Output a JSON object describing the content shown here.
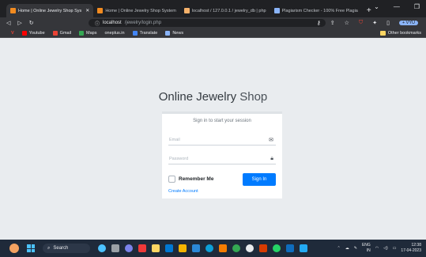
{
  "browser": {
    "tabs": [
      {
        "label": "Home | Online Jewelry Shop Sys",
        "color": "#f28b20",
        "active": true
      },
      {
        "label": "Home | Online Jewelry Shop System",
        "color": "#f28b20",
        "active": false
      },
      {
        "label": "localhost / 127.0.0.1 / jewelry_db | php",
        "color": "#f6b26b",
        "active": false
      },
      {
        "label": "Plagiarism Checker - 100% Free Plagia",
        "color": "#8ab4f8",
        "active": false
      }
    ],
    "new_tab": "+",
    "url_host": "localhost",
    "url_path": "/jewelry/login.php",
    "profile_label": "+ VYU",
    "bookmarks": [
      {
        "label": "Youtube",
        "color": "#ff0000"
      },
      {
        "label": "Gmail",
        "color": "#ea4335"
      },
      {
        "label": "Maps",
        "color": "#34a853"
      },
      {
        "label": "oneplus.in",
        "color": "#9aa0a6"
      },
      {
        "label": "Translate",
        "color": "#4285f4"
      },
      {
        "label": "News",
        "color": "#8ab4f8"
      }
    ],
    "other_bookmarks": "Other bookmarks"
  },
  "login": {
    "logo_bold": "Online Jewelry",
    "logo_light": " Shop",
    "message": "Sign in to start your session",
    "email_placeholder": "Email",
    "password_placeholder": "Password",
    "remember_label": "Remember Me",
    "signin_label": "Sign In",
    "create_account": "Create Account",
    "accent_color": "#007bff"
  },
  "taskbar": {
    "search_label": "Search",
    "lang_top": "ENG",
    "lang_bottom": "IN",
    "time": "12:38",
    "date": "17-04-2023"
  }
}
